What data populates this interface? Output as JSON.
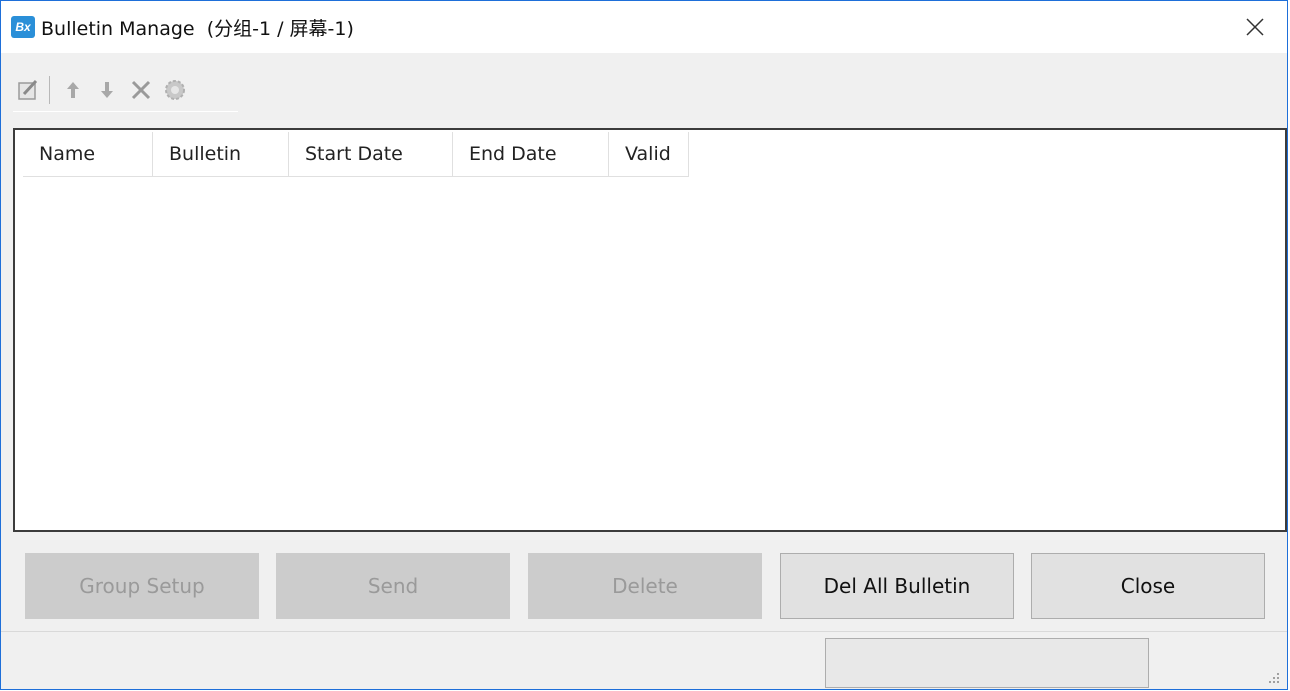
{
  "window": {
    "app_icon_label": "Bx",
    "title": "Bulletin Manage",
    "subtitle": "(分组-1 / 屏幕-1)",
    "accent_color": "#1e6fd9"
  },
  "toolbar": {
    "items": [
      {
        "icon": "edit-icon",
        "enabled": false
      },
      {
        "icon": "arrow-up-icon",
        "enabled": false
      },
      {
        "icon": "arrow-down-icon",
        "enabled": false
      },
      {
        "icon": "delete-x-icon",
        "enabled": false
      },
      {
        "icon": "gear-icon",
        "enabled": false
      }
    ]
  },
  "table": {
    "columns": [
      "Name",
      "Bulletin",
      "Start Date",
      "End Date",
      "Valid"
    ],
    "rows": []
  },
  "buttons": {
    "group_setup": "Group Setup",
    "send": "Send",
    "delete": "Delete",
    "del_all": "Del All Bulletin",
    "close": "Close"
  },
  "status": {
    "text": ""
  }
}
